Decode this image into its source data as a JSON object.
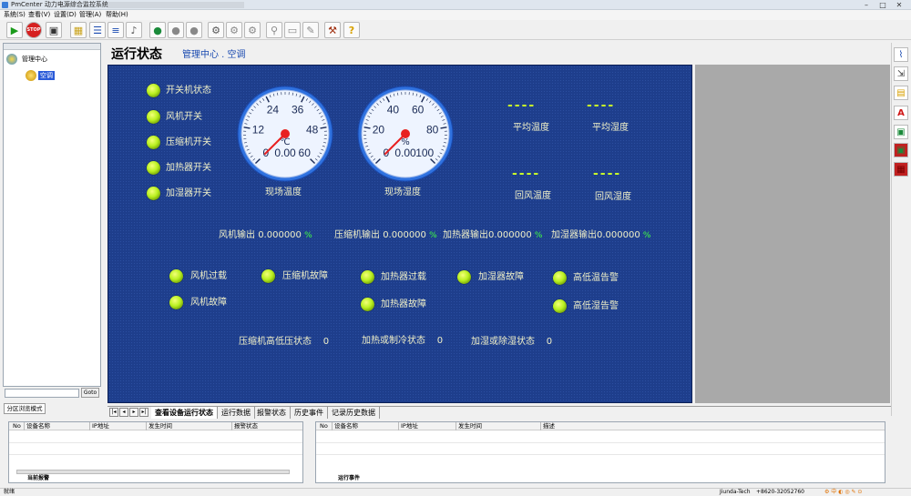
{
  "window": {
    "title": "PmCenter 动力电源综合监控系统"
  },
  "menu": [
    "系统(S)",
    "查看(V)",
    "设置(D)",
    "管理(A)",
    "帮助(H)"
  ],
  "toolbar": {
    "start_icon": "▶",
    "stop_label": "STOP",
    "save_icon": "▣"
  },
  "tree": {
    "root": "管理中心",
    "child": "空调"
  },
  "search": {
    "go_label": "Goto"
  },
  "left_tab": "分区浏览模式",
  "header": {
    "title": "运行状态",
    "subtitle": "管理中心 . 空调"
  },
  "status_lights": [
    "开关机状态",
    "风机开关",
    "压缩机开关",
    "加热器开关",
    "加湿器开关"
  ],
  "gauges": [
    {
      "label": "现场温度",
      "unit": "℃",
      "ticks": [
        "0",
        "12",
        "24",
        "36",
        "48",
        "60"
      ],
      "value": "0.00",
      "max": 60,
      "reading": 0
    },
    {
      "label": "现场湿度",
      "unit": "%",
      "ticks": [
        "0",
        "20",
        "40",
        "60",
        "80",
        "100"
      ],
      "value": "0.00",
      "max": 100,
      "reading": 0
    }
  ],
  "readings": [
    {
      "value": "----",
      "label": "平均温度"
    },
    {
      "value": "----",
      "label": "平均湿度"
    },
    {
      "value": "----",
      "label": "回风温度"
    },
    {
      "value": "----",
      "label": "回风湿度"
    }
  ],
  "outputs": [
    {
      "label": "风机输出",
      "value": "0.000000",
      "unit": "%"
    },
    {
      "label": "压缩机输出",
      "value": "0.000000",
      "unit": "%"
    },
    {
      "label": "加热器输出",
      "value": "0.000000",
      "unit": "%"
    },
    {
      "label": "加湿器输出",
      "value": "0.000000",
      "unit": "%"
    }
  ],
  "alarms": [
    "风机过载",
    "压缩机故障",
    "加热器过载",
    "加湿器故障",
    "高低温告警",
    "风机故障",
    "加热器故障",
    "高低湿告警"
  ],
  "states": [
    {
      "label": "压缩机高低压状态",
      "value": "0"
    },
    {
      "label": "加热或制冷状态",
      "value": "0"
    },
    {
      "label": "加湿或除湿状态",
      "value": "0"
    }
  ],
  "tabs": [
    "查看设备运行状态",
    "运行数据",
    "报警状态",
    "历史事件",
    "记录历史数据"
  ],
  "alarm_list": {
    "columns": [
      "No",
      "设备名称",
      "IP地址",
      "发生时间",
      "报警状态"
    ],
    "tab": "当前报警"
  },
  "event_list": {
    "columns": [
      "No",
      "设备名称",
      "IP地址",
      "发生时间",
      "描述"
    ],
    "tab": "运行事件"
  },
  "statusbar": {
    "left": "就绪",
    "company": "Jiunda-Tech",
    "phone": "+8620-32052760"
  },
  "colors": {
    "panel": "#1e3e8c",
    "led": "#b9f020",
    "label": "#f0f0c8",
    "needle": "#ff2020"
  }
}
